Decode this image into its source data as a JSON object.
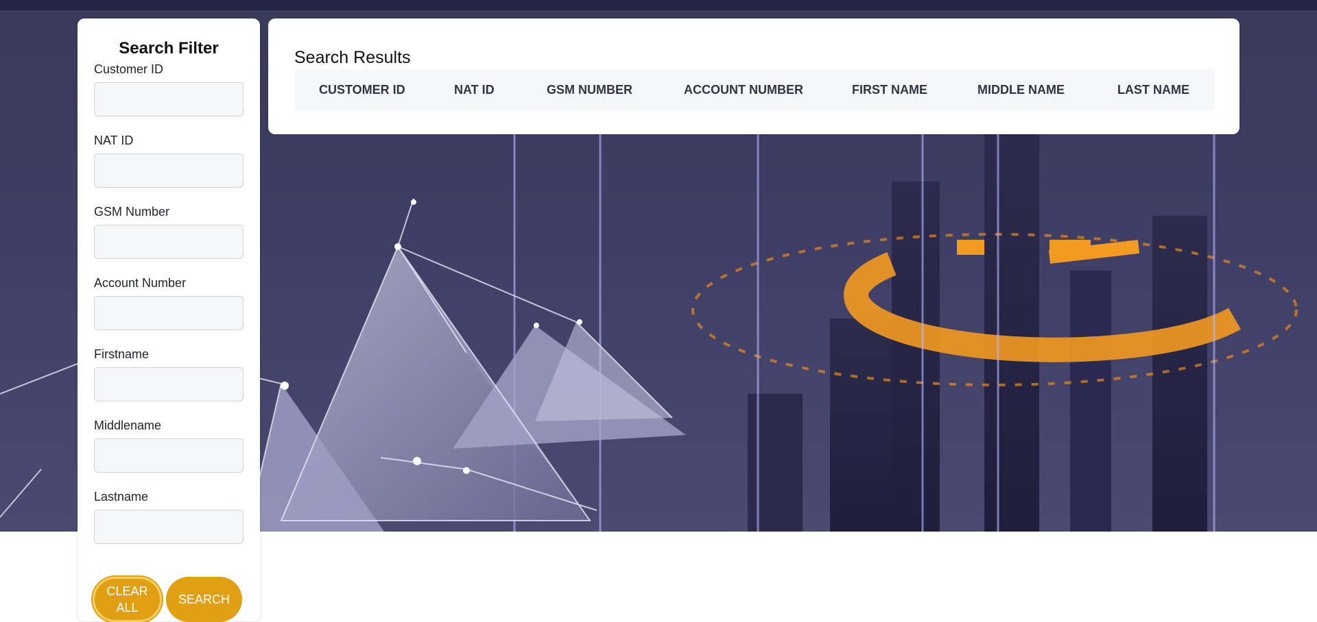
{
  "filter": {
    "title": "Search Filter",
    "fields": [
      {
        "label": "Customer ID",
        "value": "",
        "placeholder": ""
      },
      {
        "label": "NAT ID",
        "value": "",
        "placeholder": ""
      },
      {
        "label": "GSM Number",
        "value": "",
        "placeholder": ""
      },
      {
        "label": "Account Number",
        "value": "",
        "placeholder": ""
      },
      {
        "label": "Firstname",
        "value": "",
        "placeholder": ""
      },
      {
        "label": "Middlename",
        "value": "",
        "placeholder": ""
      },
      {
        "label": "Lastname",
        "value": "",
        "placeholder": ""
      }
    ],
    "clear_label": "CLEAR ALL",
    "search_label": "SEARCH"
  },
  "results": {
    "title": "Search Results",
    "columns": [
      "CUSTOMER ID",
      "NAT ID",
      "GSM NUMBER",
      "ACCOUNT NUMBER",
      "FIRST NAME",
      "MIDDLE NAME",
      "LAST NAME"
    ],
    "rows": []
  },
  "colors": {
    "accent": "#e0a011",
    "topbar": "#262545",
    "background": "#3e3d63"
  }
}
